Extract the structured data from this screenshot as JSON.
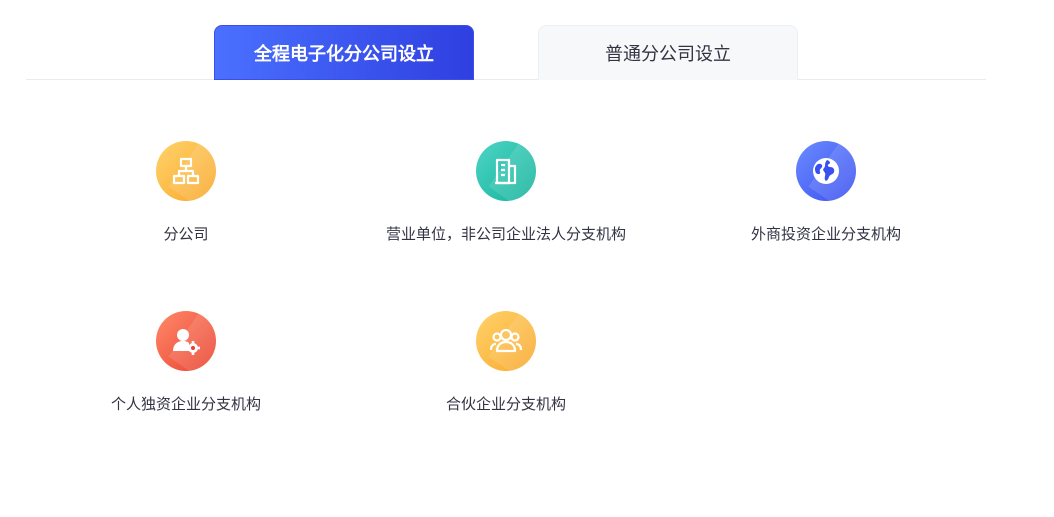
{
  "tabs": [
    {
      "label": "全程电子化分公司设立",
      "active": true
    },
    {
      "label": "普通分公司设立",
      "active": false
    }
  ],
  "items": [
    {
      "label": "分公司",
      "icon": "org-chart-icon",
      "color": "#f9a72b"
    },
    {
      "label": "营业单位，非公司企业法人分支机构",
      "icon": "building-icon",
      "color": "#12b39a"
    },
    {
      "label": "外商投资企业分支机构",
      "icon": "globe-icon",
      "color": "#3a4ff0"
    },
    {
      "label": "个人独资企业分支机构",
      "icon": "person-gear-icon",
      "color": "#e9412e"
    },
    {
      "label": "合伙企业分支机构",
      "icon": "group-icon",
      "color": "#f9a72b"
    }
  ],
  "colors": {
    "active_tab": "#3a4fe8",
    "text": "#333344"
  }
}
